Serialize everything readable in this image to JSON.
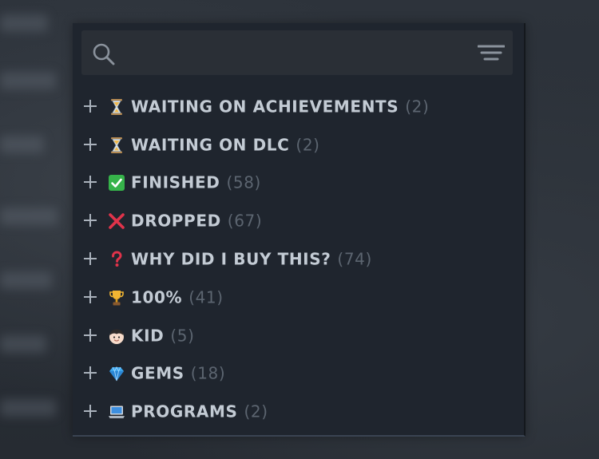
{
  "search": {
    "placeholder": ""
  },
  "collections": [
    {
      "label": "WAITING ON ACHIEVEMENTS",
      "count": "(2)",
      "icon": "hourglass-icon"
    },
    {
      "label": "WAITING ON DLC",
      "count": "(2)",
      "icon": "hourglass-icon"
    },
    {
      "label": "FINISHED",
      "count": "(58)",
      "icon": "check-mark-icon"
    },
    {
      "label": "DROPPED",
      "count": "(67)",
      "icon": "cross-mark-icon"
    },
    {
      "label": "WHY DID I BUY THIS?",
      "count": "(74)",
      "icon": "question-mark-icon"
    },
    {
      "label": "100%",
      "count": "(41)",
      "icon": "trophy-icon"
    },
    {
      "label": "KID",
      "count": "(5)",
      "icon": "child-face-icon"
    },
    {
      "label": "GEMS",
      "count": "(18)",
      "icon": "gem-icon"
    },
    {
      "label": "PROGRAMS",
      "count": "(2)",
      "icon": "laptop-icon"
    }
  ],
  "colors": {
    "panel_bg": "#1f252e",
    "search_bg": "#2a2f36",
    "label_text": "#c3cbd4",
    "count_text": "#5c6570",
    "check_green": "#36b34a",
    "cross_red": "#e0334a"
  }
}
